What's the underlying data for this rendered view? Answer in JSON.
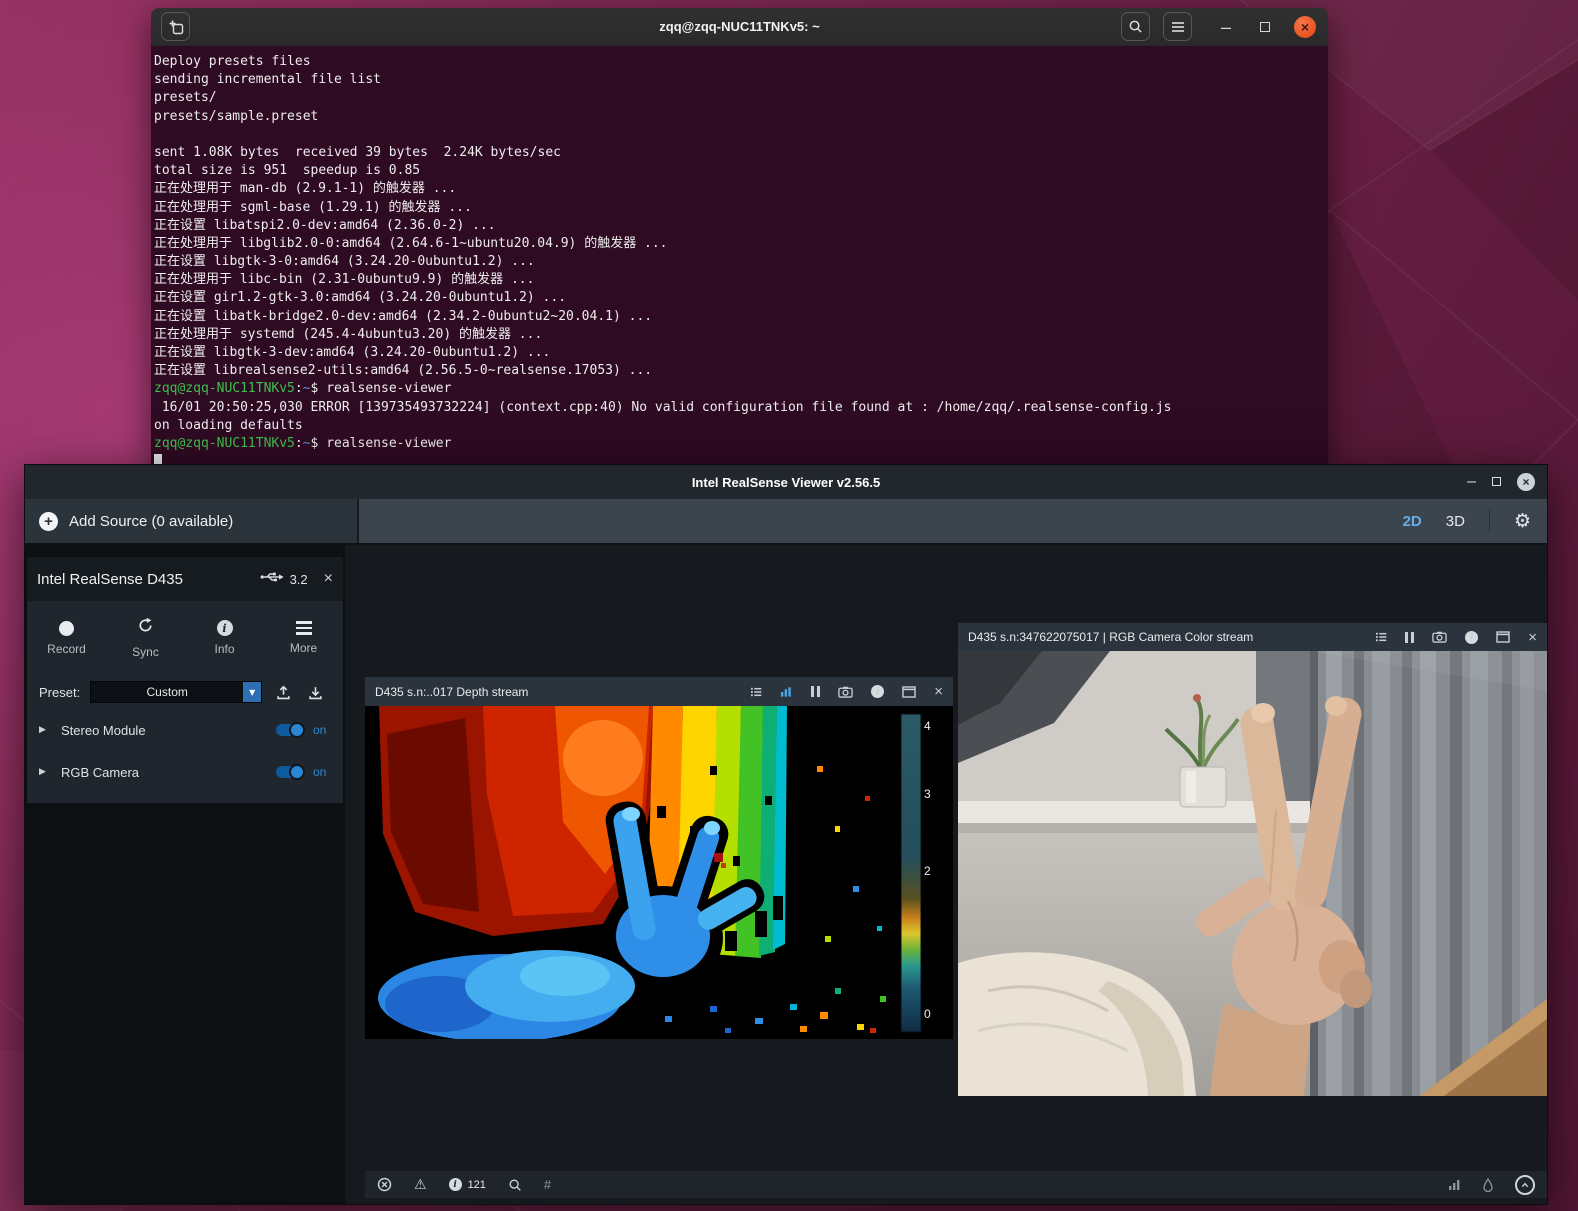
{
  "terminal": {
    "title": "zqq@zqq-NUC11TNKv5: ~",
    "lines": [
      [
        {
          "t": "Deploy presets files"
        }
      ],
      [
        {
          "t": "sending incremental file list"
        }
      ],
      [
        {
          "t": "presets/"
        }
      ],
      [
        {
          "t": "presets/sample.preset"
        }
      ],
      [
        {
          "t": ""
        }
      ],
      [
        {
          "t": "sent 1.08K bytes  received 39 bytes  2.24K bytes/sec"
        }
      ],
      [
        {
          "t": "total size is 951  speedup is 0.85"
        }
      ],
      [
        {
          "t": "正在处理用于 man-db (2.9.1-1) 的触发器 ..."
        }
      ],
      [
        {
          "t": "正在处理用于 sgml-base (1.29.1) 的触发器 ..."
        }
      ],
      [
        {
          "t": "正在设置 libatspi2.0-dev:amd64 (2.36.0-2) ..."
        }
      ],
      [
        {
          "t": "正在处理用于 libglib2.0-0:amd64 (2.64.6-1~ubuntu20.04.9) 的触发器 ..."
        }
      ],
      [
        {
          "t": "正在设置 libgtk-3-0:amd64 (3.24.20-0ubuntu1.2) ..."
        }
      ],
      [
        {
          "t": "正在处理用于 libc-bin (2.31-0ubuntu9.9) 的触发器 ..."
        }
      ],
      [
        {
          "t": "正在设置 gir1.2-gtk-3.0:amd64 (3.24.20-0ubuntu1.2) ..."
        }
      ],
      [
        {
          "t": "正在设置 libatk-bridge2.0-dev:amd64 (2.34.2-0ubuntu2~20.04.1) ..."
        }
      ],
      [
        {
          "t": "正在处理用于 systemd (245.4-4ubuntu3.20) 的触发器 ..."
        }
      ],
      [
        {
          "t": "正在设置 libgtk-3-dev:amd64 (3.24.20-0ubuntu1.2) ..."
        }
      ],
      [
        {
          "t": "正在设置 librealsense2-utils:amd64 (2.56.5-0~realsense.17053) ..."
        }
      ],
      [
        {
          "t": "zqq@zqq-NUC11TNKv5",
          "c": "g"
        },
        {
          "t": ":"
        },
        {
          "t": "~",
          "c": "b"
        },
        {
          "t": "$ realsense-viewer"
        }
      ],
      [
        {
          "t": " 16/01 20:50:25,030 ERROR [139735493732224] (context.cpp:40) No valid configuration file found at : /home/zqq/.realsense-config.js"
        }
      ],
      [
        {
          "t": "on loading defaults"
        }
      ],
      [
        {
          "t": "zqq@zqq-NUC11TNKv5",
          "c": "g"
        },
        {
          "t": ":"
        },
        {
          "t": "~",
          "c": "b"
        },
        {
          "t": "$ realsense-viewer"
        }
      ]
    ]
  },
  "viewer": {
    "title": "Intel RealSense Viewer v2.56.5",
    "toolbar": {
      "add_source_label": "Add Source (0 available)",
      "view_2d": "2D",
      "view_3d": "3D"
    },
    "device_panel": {
      "name": "Intel RealSense D435",
      "usb_version": "3.2",
      "actions": [
        {
          "label": "Record"
        },
        {
          "label": "Sync"
        },
        {
          "label": "Info"
        },
        {
          "label": "More"
        }
      ],
      "preset_label": "Preset:",
      "preset_value": "Custom",
      "modules": [
        {
          "label": "Stereo Module",
          "state": "on"
        },
        {
          "label": "RGB Camera",
          "state": "on"
        }
      ]
    },
    "depth_panel": {
      "title": "D435 s.n:..017 Depth stream",
      "scale_ticks": [
        "4",
        "3",
        "2",
        "0"
      ]
    },
    "rgb_panel": {
      "title": "D435 s.n:347622075017 | RGB Camera Color stream"
    },
    "statusbar": {
      "info_count": "121",
      "hash_label": "#"
    }
  },
  "icons": {
    "plus": "+",
    "close": "×",
    "minimize": "–",
    "dropdown_arrow": "▼",
    "expand_arrow": "▶",
    "gear": "⚙",
    "warning": "⚠",
    "info_letter": "i"
  },
  "colors": {
    "accent_blue": "#2d86d4",
    "tab_active": "#64aee8",
    "terminal_bg": "#2f0a23",
    "prompt_green": "#3fbf4e",
    "prompt_blue": "#5b8fd6"
  }
}
